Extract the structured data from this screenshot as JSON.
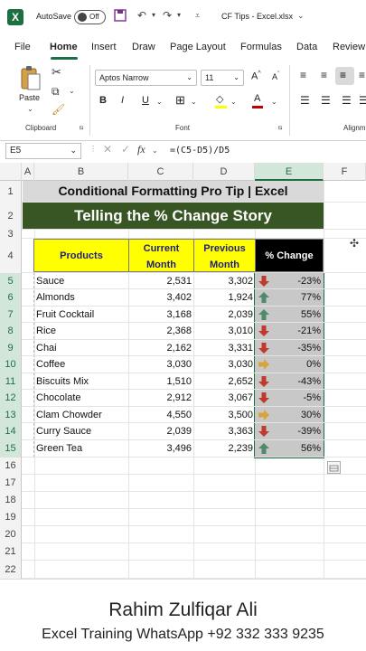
{
  "titlebar": {
    "app_icon": "X",
    "autosave": "AutoSave",
    "toggle_state": "Off",
    "document": "CF Tips - Excel.xlsx"
  },
  "menu": [
    "File",
    "Home",
    "Insert",
    "Draw",
    "Page Layout",
    "Formulas",
    "Data",
    "Review"
  ],
  "ribbon": {
    "paste": "Paste",
    "clipboard": "Clipboard",
    "font_name": "Aptos Narrow",
    "font_size": "11",
    "font_group": "Font",
    "align_group": "Alignm",
    "bold": "B",
    "italic": "I",
    "underline": "U"
  },
  "formulabar": {
    "namebox": "E5",
    "fx": "fx",
    "formula": "=(C5-D5)/D5"
  },
  "columns": [
    "A",
    "B",
    "C",
    "D",
    "E",
    "F"
  ],
  "rows": [
    "1",
    "2",
    "3",
    "4",
    "5",
    "6",
    "7",
    "8",
    "9",
    "10",
    "11",
    "12",
    "13",
    "14",
    "15",
    "16",
    "17",
    "18",
    "19",
    "20",
    "21",
    "22"
  ],
  "sheet": {
    "title1": "Conditional Formatting Pro Tip | Excel",
    "title2": "Telling the % Change Story",
    "headers": {
      "products": "Products",
      "current1": "Current",
      "current2": "Month",
      "previous1": "Previous",
      "previous2": "Month",
      "change": "% Change"
    },
    "data": [
      {
        "product": "Sauce",
        "current": "2,531",
        "previous": "3,302",
        "change": "-23%",
        "arrow": "down"
      },
      {
        "product": "Almonds",
        "current": "3,402",
        "previous": "1,924",
        "change": "77%",
        "arrow": "up"
      },
      {
        "product": "Fruit Cocktail",
        "current": "3,168",
        "previous": "2,039",
        "change": "55%",
        "arrow": "up"
      },
      {
        "product": "Rice",
        "current": "2,368",
        "previous": "3,010",
        "change": "-21%",
        "arrow": "down"
      },
      {
        "product": "Chai",
        "current": "2,162",
        "previous": "3,331",
        "change": "-35%",
        "arrow": "down"
      },
      {
        "product": "Coffee",
        "current": "3,030",
        "previous": "3,030",
        "change": "0%",
        "arrow": "right"
      },
      {
        "product": "Biscuits Mix",
        "current": "1,510",
        "previous": "2,652",
        "change": "-43%",
        "arrow": "down"
      },
      {
        "product": "Chocolate",
        "current": "2,912",
        "previous": "3,067",
        "change": "-5%",
        "arrow": "down"
      },
      {
        "product": "Clam Chowder",
        "current": "4,550",
        "previous": "3,500",
        "change": "30%",
        "arrow": "right"
      },
      {
        "product": "Curry Sauce",
        "current": "2,039",
        "previous": "3,363",
        "change": "-39%",
        "arrow": "down"
      },
      {
        "product": "Green Tea",
        "current": "3,496",
        "previous": "2,239",
        "change": "56%",
        "arrow": "up"
      }
    ]
  },
  "footer": {
    "name": "Rahim Zulfiqar Ali",
    "whatsapp": "Excel Training WhatsApp +92 332 333 9235"
  },
  "colors": {
    "up": "#4e8a6b",
    "down": "#c0392b",
    "right": "#d9a33b",
    "accent": "#1d6f42"
  }
}
